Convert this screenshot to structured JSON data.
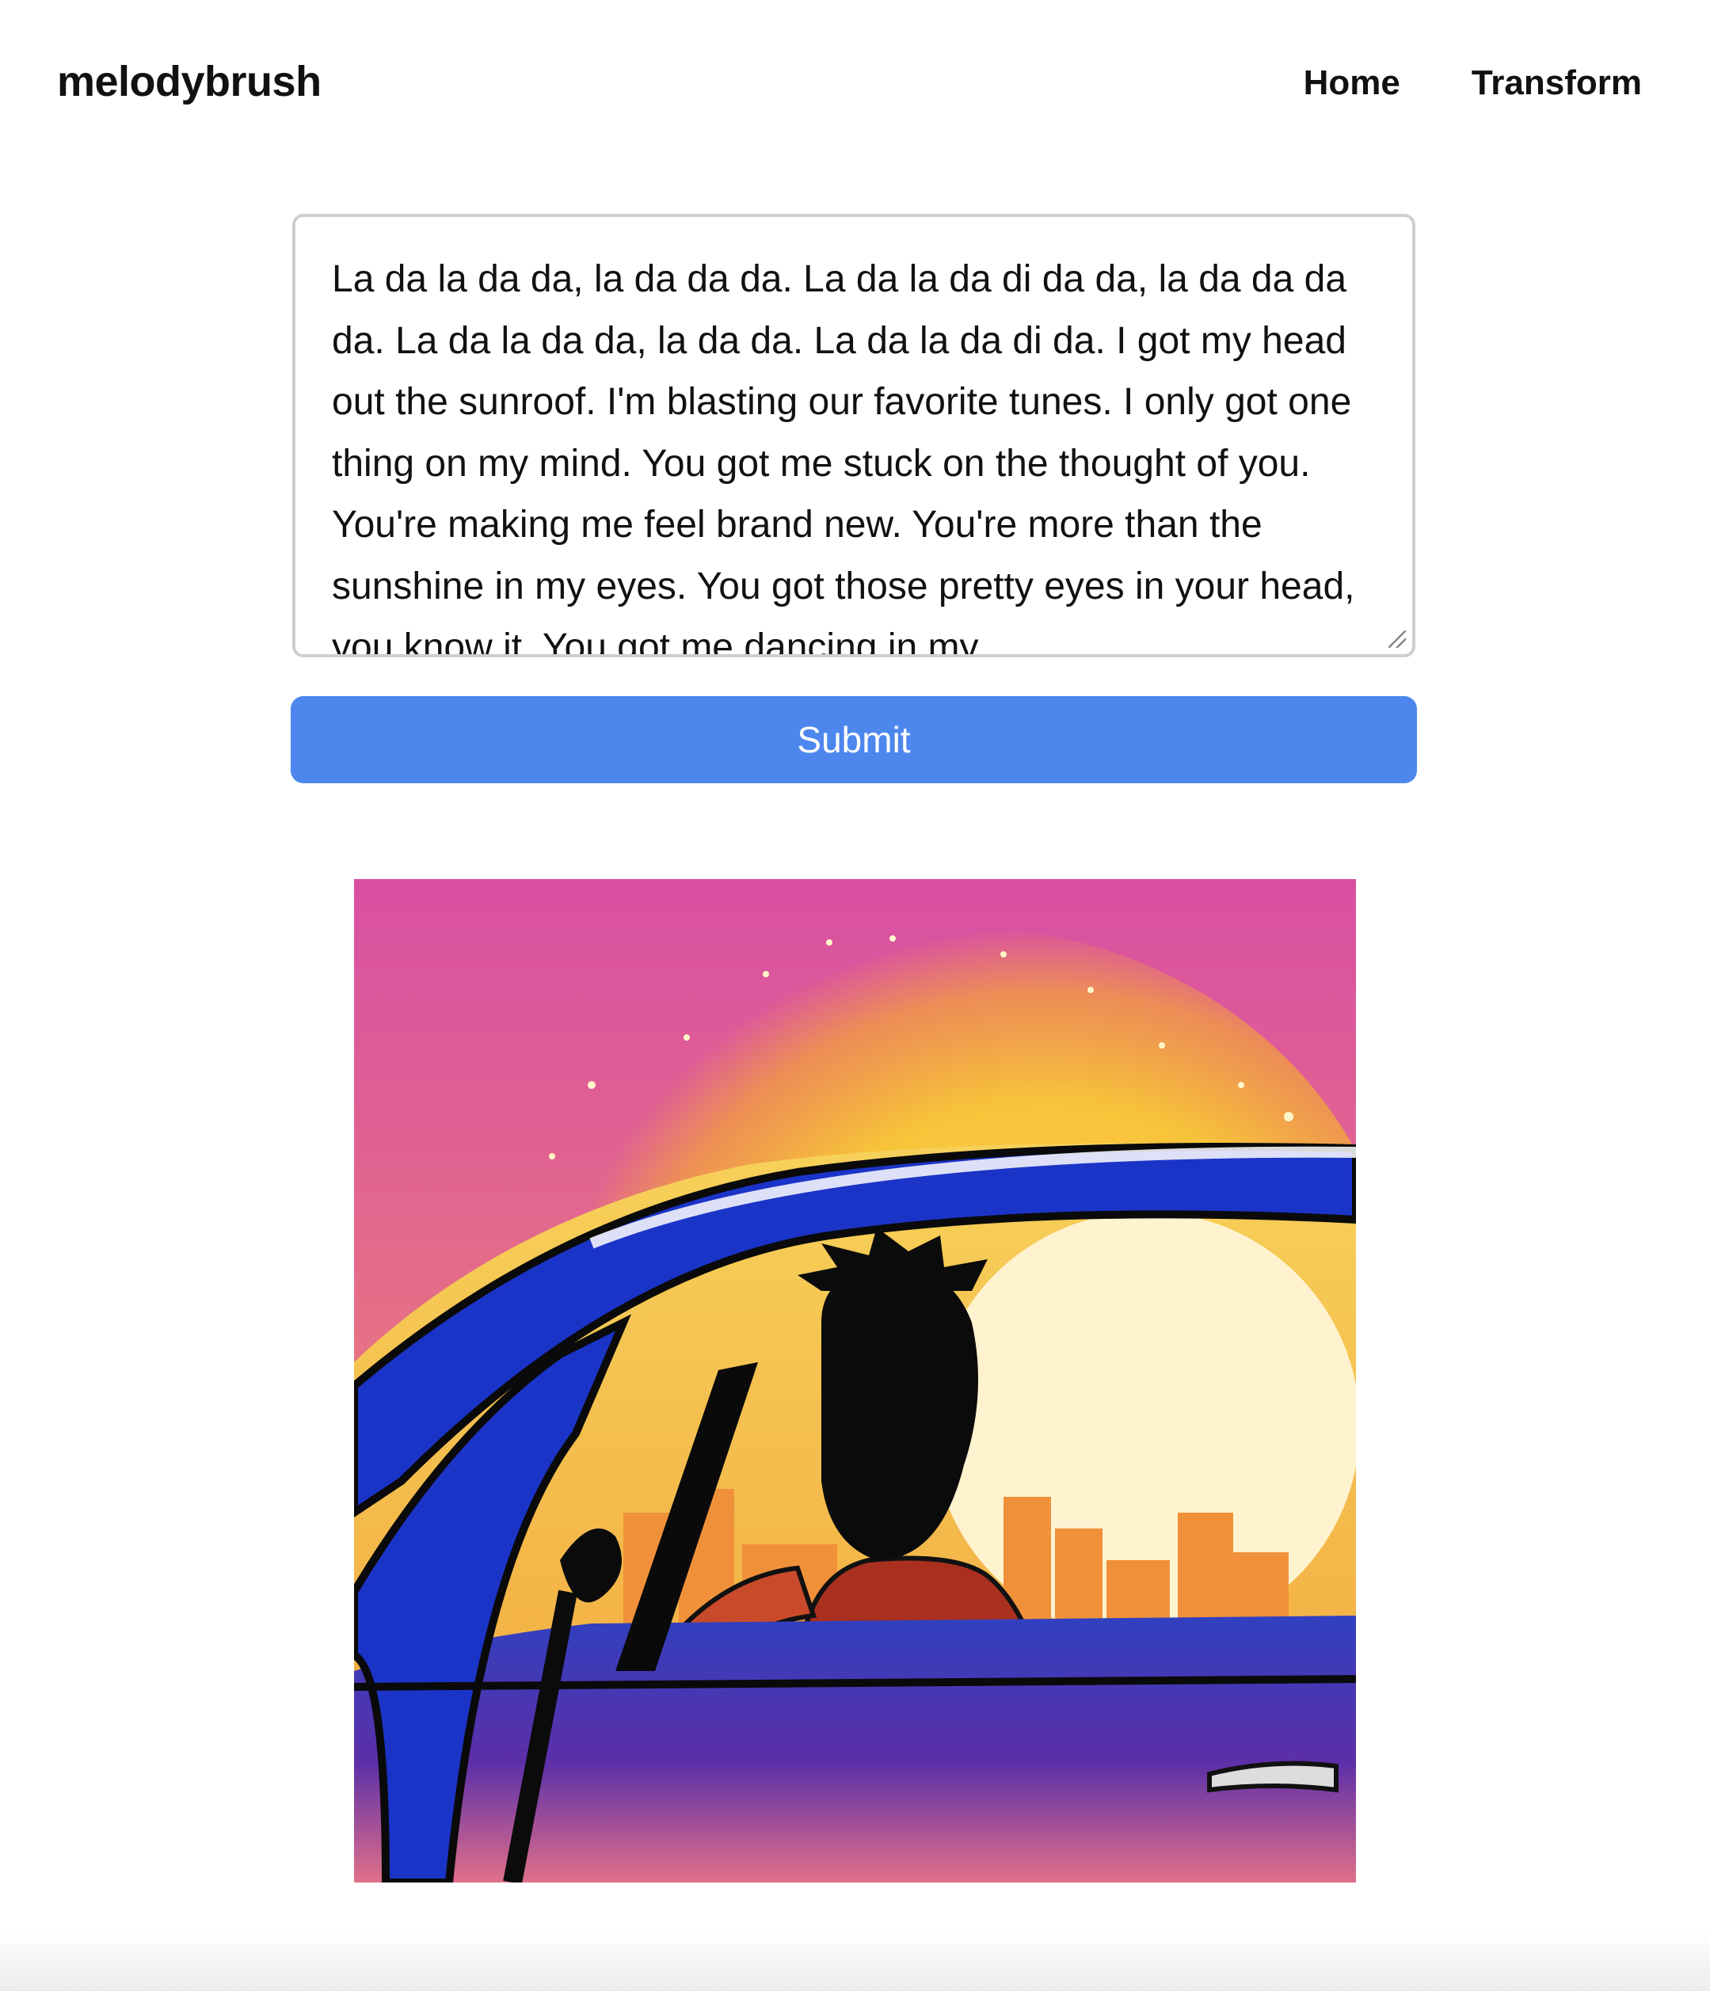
{
  "header": {
    "logo": "melodybrush",
    "nav": [
      {
        "label": "Home"
      },
      {
        "label": "Transform"
      }
    ]
  },
  "form": {
    "lyrics_value": "La da la da da, la da da da. La da la da di da da, la da da da da. La da la da da, la da da. La da la da di da. I got my head out the sunroof. I'm blasting our favorite tunes. I only got one thing on my mind. You got me stuck on the thought of you. You're making me feel brand new. You're more than the sunshine in my eyes. You got those pretty eyes in your head, you know it. You got me dancing in my",
    "submit_label": "Submit"
  },
  "image": {
    "description_icon": "generated-artwork-image"
  },
  "colors": {
    "accent": "#4d87ee",
    "text": "#111111",
    "border": "#cfcfcf"
  }
}
